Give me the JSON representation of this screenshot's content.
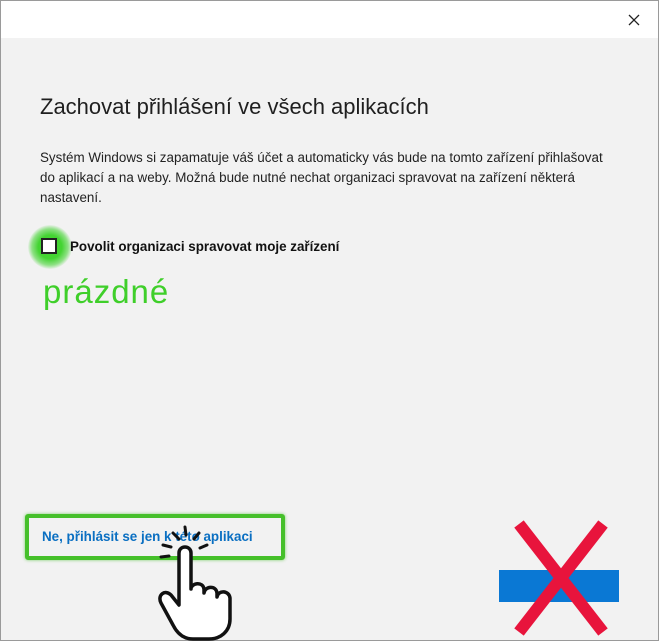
{
  "dialog": {
    "title": "Zachovat přihlášení ve všech aplikacích",
    "description": "Systém Windows si zapamatuje váš účet a automaticky vás bude na tomto zařízení přihlašovat do aplikací a na weby. Možná bude nutné nechat organizaci spravovat na zařízení některá nastavení.",
    "checkbox_label": "Povolit organizaci spravovat moje zařízení",
    "checkbox_checked": false,
    "link_label": "Ne, přihlásit se jen k této aplikaci",
    "close_icon": "close-icon"
  },
  "annotation": {
    "checkbox_note": "prázdné",
    "highlight_color": "#45c02a",
    "cross_color": "#e8143c"
  },
  "colors": {
    "accent": "#0a78d4",
    "link": "#0a6fc2",
    "dialog_bg": "#f2f2f2"
  }
}
